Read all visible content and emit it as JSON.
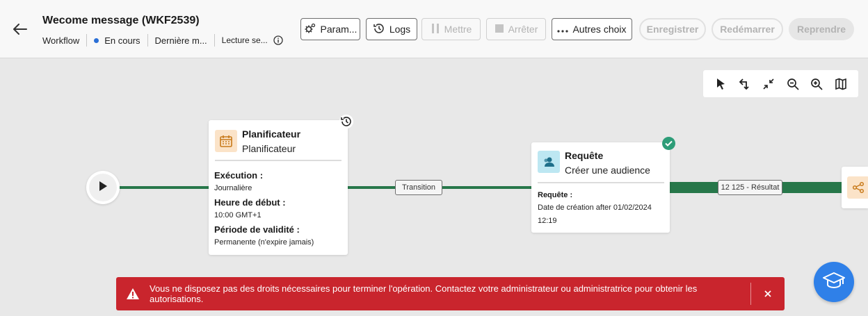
{
  "header": {
    "title": "Wecome message (WKF2539)",
    "workflow_label": "Workflow",
    "status_label": "En cours",
    "last_modified_label": "Dernière m...",
    "reading_label": "Lecture se..."
  },
  "toolbar_buttons": {
    "params": "Param...",
    "logs": "Logs",
    "pause": "Mettre",
    "stop": "Arrêter",
    "more": "Autres choix",
    "save": "Enregistrer",
    "restart": "Redémarrer",
    "resume": "Reprendre"
  },
  "canvas_tools": [
    "pointer-icon",
    "redo-link-icon",
    "collapse-icon",
    "zoom-out-icon",
    "zoom-in-icon",
    "map-icon"
  ],
  "scheduler_card": {
    "title": "Planificateur",
    "subtitle": "Planificateur",
    "execution_label": "Exécution :",
    "execution_value": "Journalière",
    "start_label": "Heure de début :",
    "start_value": "10:00 GMT+1",
    "validity_label": "Période de validité :",
    "validity_value": "Permanente (n'expire jamais)"
  },
  "transition_label": "Transition",
  "query_card": {
    "title": "Requête",
    "subtitle": "Créer une audience",
    "query_label": "Requête :",
    "query_value_1": "Date de création after  01/02/2024",
    "query_value_2": "12:19"
  },
  "result_label": "12 125 - Résultat",
  "toast": {
    "message": "Vous ne disposez pas des droits nécessaires pour terminer l'opération. Contactez votre administrateur ou administratrice pour obtenir les autorisations."
  },
  "colors": {
    "accent_blue": "#2a6fd6",
    "flow_green": "#27774a",
    "error_red": "#c9252d",
    "help_blue": "#2f80e8"
  }
}
